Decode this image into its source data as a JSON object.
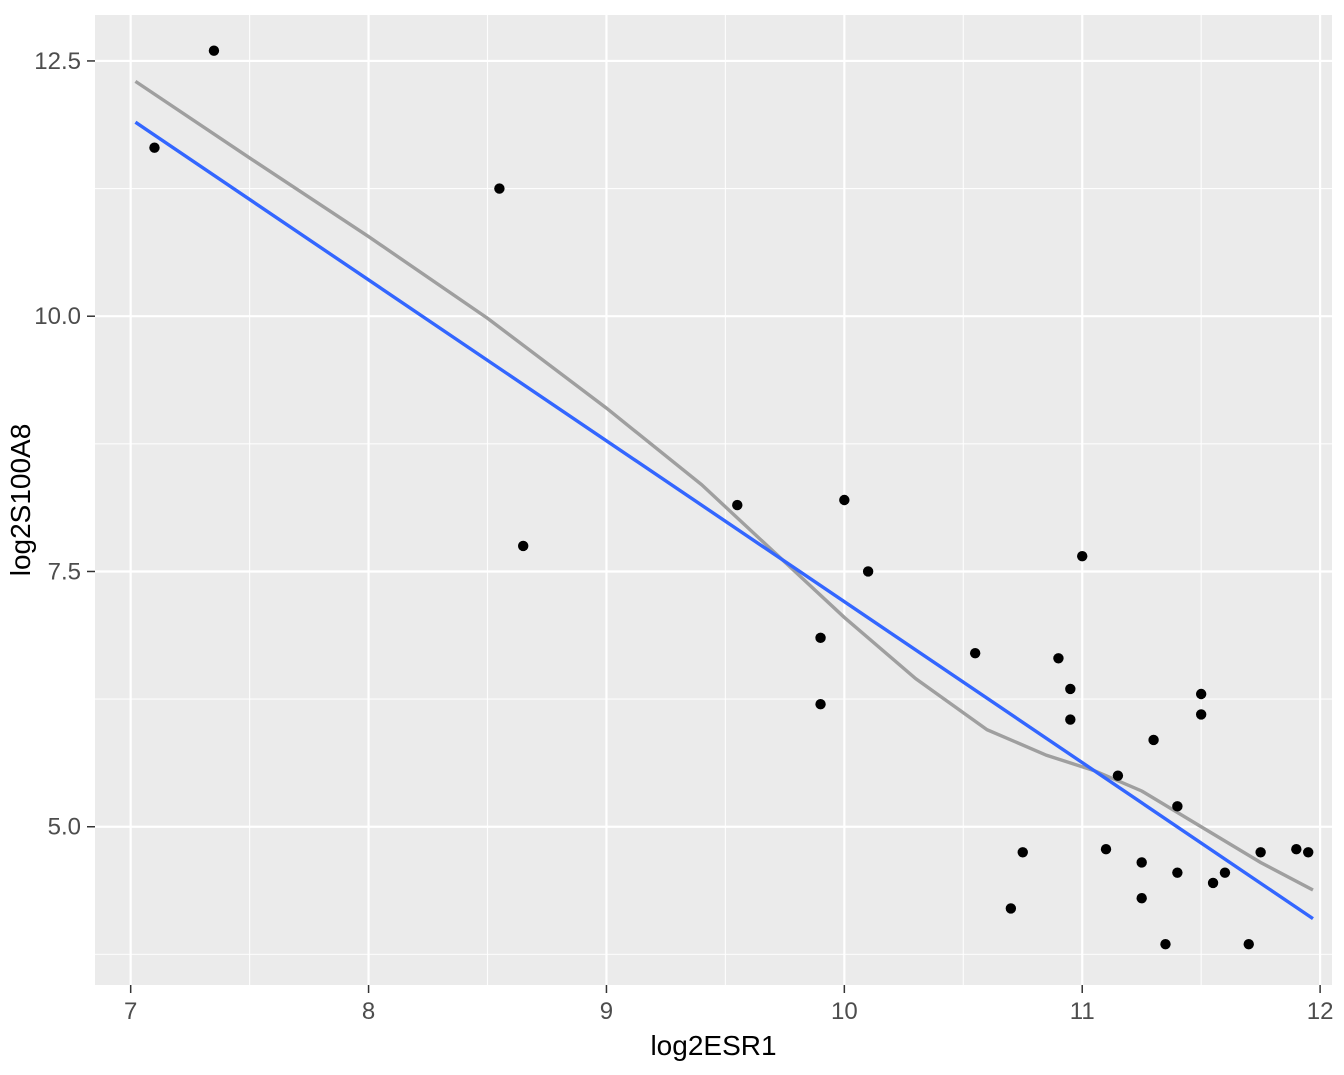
{
  "chart_data": {
    "type": "scatter",
    "title": "",
    "xlabel": "log2ESR1",
    "ylabel": "log2S100A8",
    "xlim": [
      6.85,
      12.05
    ],
    "ylim": [
      3.45,
      12.95
    ],
    "grid": true,
    "x_ticks": [
      7,
      8,
      9,
      10,
      11,
      12
    ],
    "y_ticks": [
      5.0,
      7.5,
      10.0,
      12.5
    ],
    "x_minor": [
      7.5,
      8.5,
      9.5,
      10.5,
      11.5
    ],
    "y_minor": [
      3.75,
      6.25,
      8.75,
      11.25
    ],
    "series": [
      {
        "name": "points",
        "kind": "scatter",
        "color": "#000000",
        "points": [
          [
            7.1,
            11.65
          ],
          [
            7.35,
            12.6
          ],
          [
            8.55,
            11.25
          ],
          [
            8.65,
            7.75
          ],
          [
            9.55,
            8.15
          ],
          [
            9.9,
            6.85
          ],
          [
            9.9,
            6.2
          ],
          [
            10.0,
            8.2
          ],
          [
            10.1,
            7.5
          ],
          [
            10.55,
            6.7
          ],
          [
            10.7,
            4.2
          ],
          [
            10.75,
            4.75
          ],
          [
            10.9,
            6.65
          ],
          [
            10.95,
            6.05
          ],
          [
            10.95,
            6.35
          ],
          [
            11.0,
            7.65
          ],
          [
            11.1,
            4.78
          ],
          [
            11.15,
            5.5
          ],
          [
            11.25,
            4.65
          ],
          [
            11.25,
            4.3
          ],
          [
            11.3,
            5.85
          ],
          [
            11.35,
            3.85
          ],
          [
            11.4,
            4.55
          ],
          [
            11.4,
            5.2
          ],
          [
            11.5,
            6.1
          ],
          [
            11.5,
            6.3
          ],
          [
            11.55,
            4.45
          ],
          [
            11.6,
            4.55
          ],
          [
            11.7,
            3.85
          ],
          [
            11.75,
            4.75
          ],
          [
            11.9,
            4.78
          ],
          [
            11.95,
            4.75
          ]
        ]
      },
      {
        "name": "lm",
        "kind": "line",
        "color": "#3366FF",
        "points": [
          [
            7.02,
            11.9
          ],
          [
            11.97,
            4.1
          ]
        ]
      },
      {
        "name": "loess",
        "kind": "path",
        "color": "#9F9F9F",
        "points": [
          [
            7.02,
            12.3
          ],
          [
            7.5,
            11.55
          ],
          [
            8.0,
            10.78
          ],
          [
            8.5,
            9.98
          ],
          [
            9.0,
            9.1
          ],
          [
            9.4,
            8.35
          ],
          [
            9.7,
            7.7
          ],
          [
            10.0,
            7.05
          ],
          [
            10.3,
            6.45
          ],
          [
            10.6,
            5.95
          ],
          [
            10.85,
            5.7
          ],
          [
            11.05,
            5.55
          ],
          [
            11.25,
            5.35
          ],
          [
            11.5,
            5.0
          ],
          [
            11.75,
            4.65
          ],
          [
            11.97,
            4.38
          ]
        ]
      }
    ]
  }
}
